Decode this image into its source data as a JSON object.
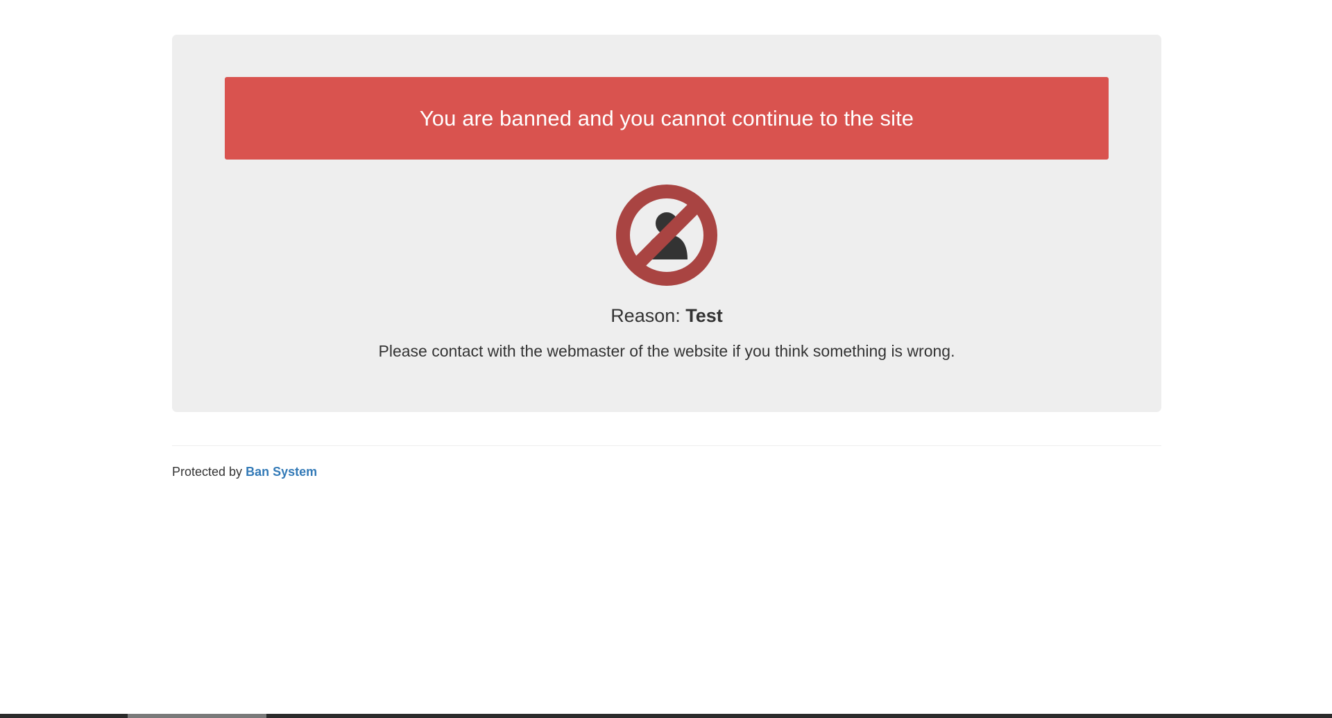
{
  "alert": {
    "message": "You are banned and you cannot continue to the site"
  },
  "ban": {
    "icon": "banned-user-icon",
    "reason_label": "Reason:",
    "reason_value": "Test",
    "contact_message": "Please contact with the webmaster of the website if you think something is wrong."
  },
  "footer": {
    "prefix": "Protected by",
    "link_text": "Ban System"
  },
  "colors": {
    "alert_background": "#d9534f",
    "panel_background": "#eeeeee",
    "icon_ring": "#a94442",
    "icon_person": "#333333",
    "link": "#337ab7"
  }
}
